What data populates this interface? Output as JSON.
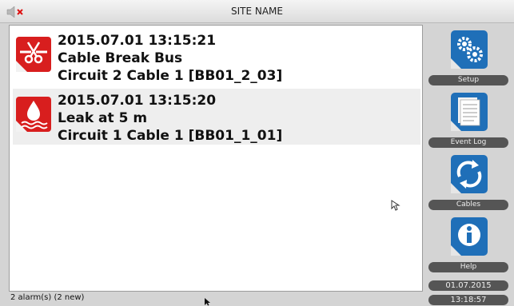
{
  "window": {
    "title": "SITE NAME"
  },
  "alarms": [
    {
      "timestamp": "2015.07.01 13:15:21",
      "description": "Cable Break Bus",
      "location": "Circuit 2 Cable 1 [BB01_2_03]",
      "icon": "cable-break-icon"
    },
    {
      "timestamp": "2015.07.01 13:15:20",
      "description": "Leak at 5 m",
      "location": "Circuit 1 Cable 1 [BB01_1_01]",
      "icon": "leak-icon"
    }
  ],
  "sidebar": {
    "buttons": [
      {
        "label": "Setup",
        "icon": "gear-icon"
      },
      {
        "label": "Event Log",
        "icon": "document-icon"
      },
      {
        "label": "Cables",
        "icon": "refresh-icon"
      },
      {
        "label": "Help",
        "icon": "info-icon"
      }
    ],
    "date": "01.07.2015",
    "time": "13:18:57"
  },
  "status": {
    "text": "2 alarm(s) (2 new)"
  },
  "colors": {
    "alarm_red": "#d81e1e",
    "button_blue": "#1f6fb8",
    "label_gray": "#555555"
  }
}
